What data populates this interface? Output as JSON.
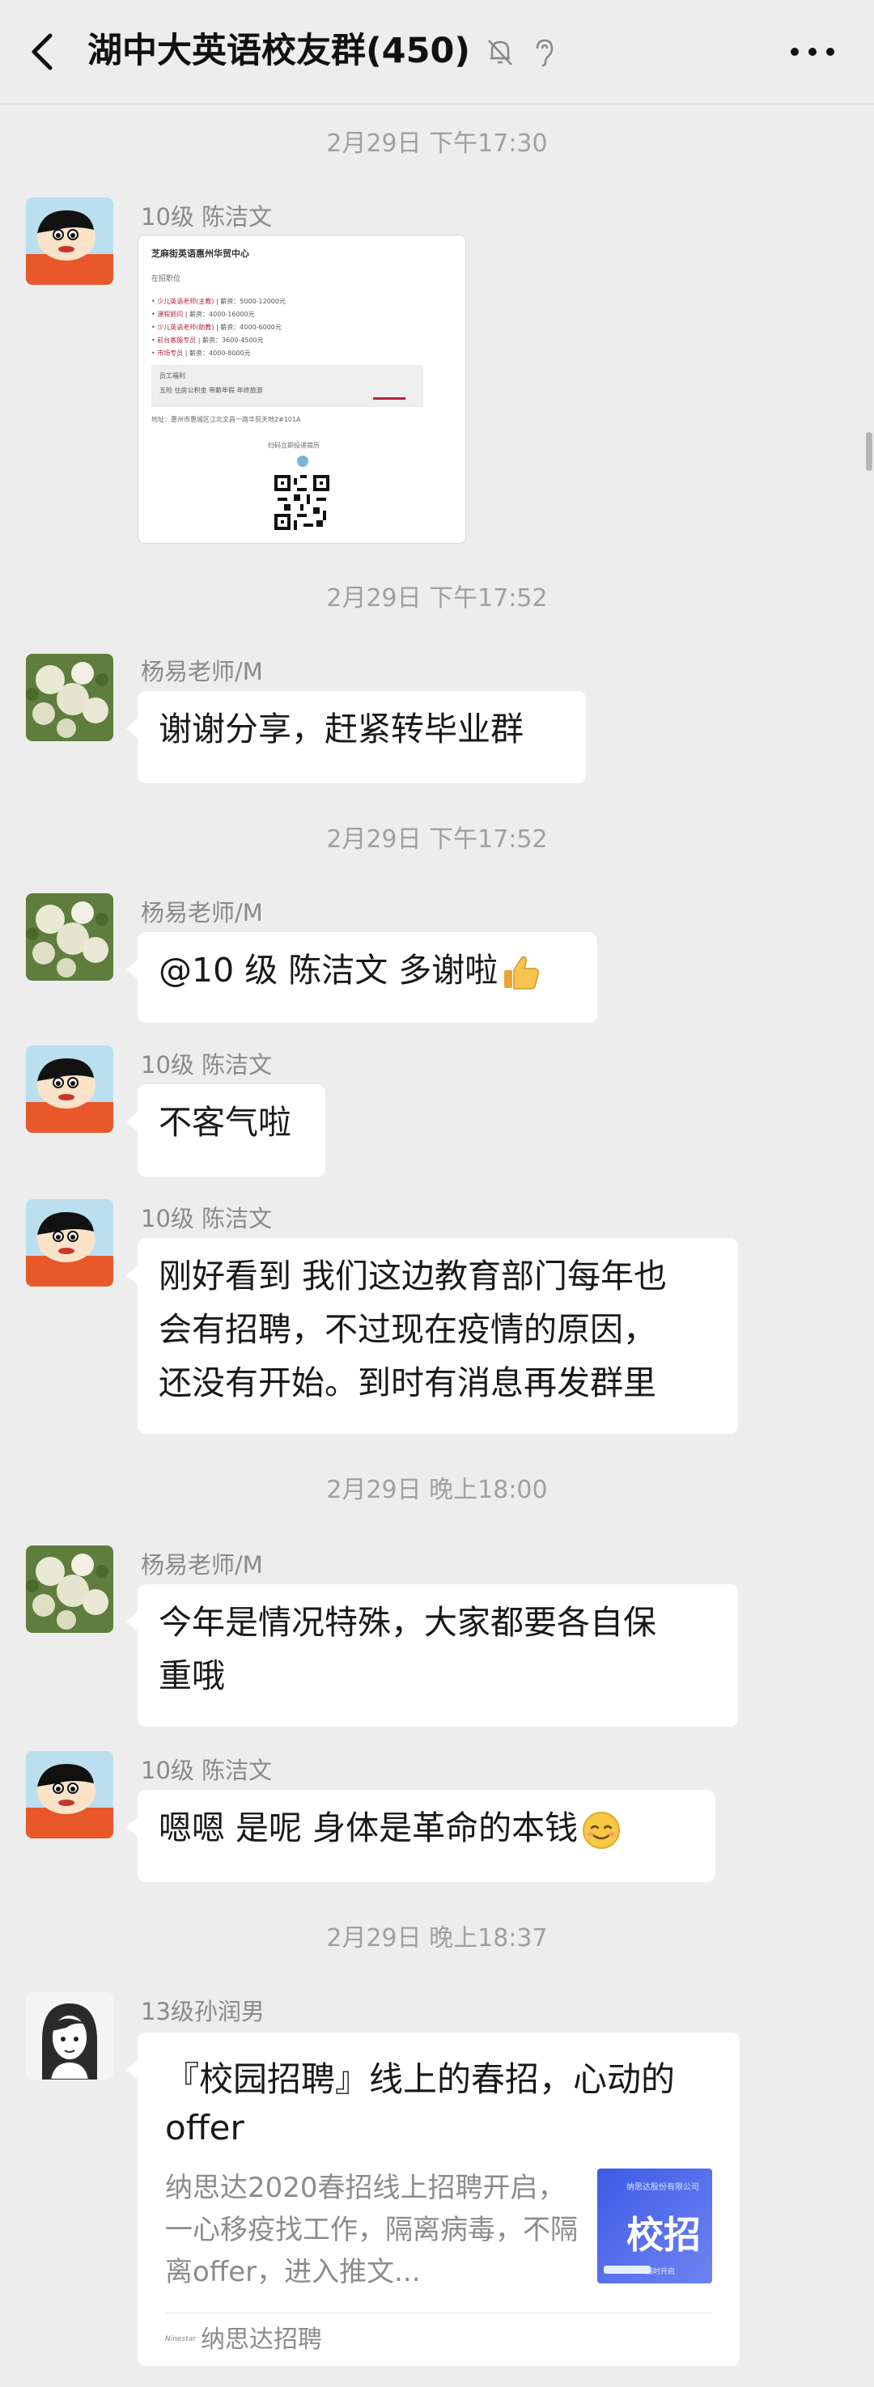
{
  "header": {
    "title": "湖中大英语校友群(450)"
  },
  "poster": {
    "title": "芝麻街英语惠州华贸中心",
    "subtitle": "在招职位",
    "jobs": [
      {
        "role": "少儿英语老师(主教)",
        "salary": "薪资：5000-12000元"
      },
      {
        "role": "课程顾问",
        "salary": "薪资：4000-16000元"
      },
      {
        "role": "少儿英语老师(助教)",
        "salary": "薪资：4000-6000元"
      },
      {
        "role": "前台客服专员",
        "salary": "薪资：3600-4500元"
      },
      {
        "role": "市场专员",
        "salary": "薪资：4000-8000元"
      }
    ],
    "welfare_title": "员工福利",
    "welfare": "五险  住房公积金  带薪年假  年终旅游",
    "address": "地址：惠州市惠城区江北文昌一路华贸天地2#101A",
    "scan_hint": "扫码立即投递简历"
  },
  "timestamps": [
    "2月29日 下午17:30",
    "2月29日 下午17:52",
    "2月29日 下午17:52",
    "2月29日 晚上18:00",
    "2月29日 晚上18:37"
  ],
  "senders": {
    "chen": "10级 陈洁文",
    "yang": "杨易老师/M",
    "sun": "13级孙润男"
  },
  "messages": {
    "m1": "谢谢分享，赶紧转毕业群",
    "m2": "@10 级 陈洁文  多谢啦",
    "m3": "不客气啦",
    "m4_l1": "刚好看到 我们这边教育部门每年也",
    "m4_l2": "会有招聘，不过现在疫情的原因，",
    "m4_l3": "还没有开始。到时有消息再发群里",
    "m5_l1": "今年是情况特殊，大家都要各自保",
    "m5_l2": "重哦",
    "m6": "嗯嗯  是呢   身体是革命的本钱"
  },
  "card": {
    "title": "『校园招聘』线上的春招，心动的offer",
    "desc": "纳思达2020春招线上招聘开启，一心移疫找工作，隔离病毒，不隔离offer，进入推文...",
    "thumb_small": "纳思达股份有限公司",
    "thumb_big": "校招",
    "thumb_chip": "限时开启",
    "logo_text": "Ninestar",
    "source": "纳思达招聘"
  },
  "icons": {
    "back": "back-arrow-icon",
    "mute": "bell-mute-icon",
    "ear": "earpiece-icon",
    "more": "more-dots-icon"
  }
}
